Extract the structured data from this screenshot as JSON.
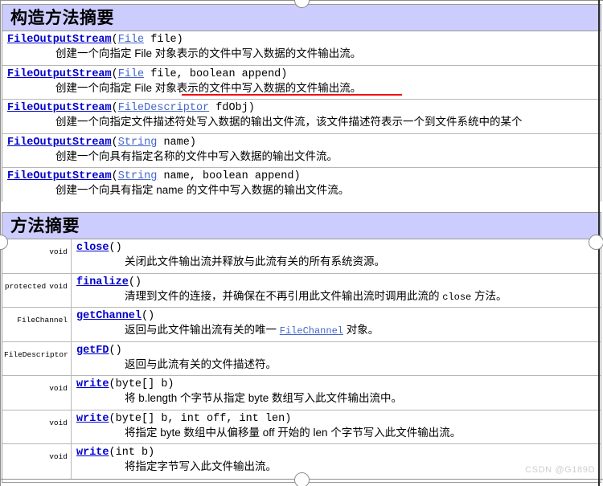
{
  "constructor_section": {
    "title": "构造方法摘要",
    "rows": [
      {
        "sig_name": "FileOutputStream",
        "sig_params_pre": "(",
        "sig_type": "File",
        "sig_params_post": " file)",
        "desc": "创建一个向指定 File 对象表示的文件中写入数据的文件输出流。"
      },
      {
        "sig_name": "FileOutputStream",
        "sig_params_pre": "(",
        "sig_type": "File",
        "sig_params_post": " file, boolean append)",
        "desc": "创建一个向指定 File 对象表示的文件中写入数据的文件输出流。"
      },
      {
        "sig_name": "FileOutputStream",
        "sig_params_pre": "(",
        "sig_type": "FileDescriptor",
        "sig_params_post": " fdObj)",
        "desc": "创建一个向指定文件描述符处写入数据的输出文件流，该文件描述符表示一个到文件系统中的某个"
      },
      {
        "sig_name": "FileOutputStream",
        "sig_params_pre": "(",
        "sig_type": "String",
        "sig_params_post": " name)",
        "desc": "创建一个向具有指定名称的文件中写入数据的输出文件流。"
      },
      {
        "sig_name": "FileOutputStream",
        "sig_params_pre": "(",
        "sig_type": "String",
        "sig_params_post": " name, boolean append)",
        "desc": "创建一个向具有指定 name 的文件中写入数据的输出文件流。"
      }
    ]
  },
  "method_section": {
    "title": "方法摘要",
    "rows": [
      {
        "modifier": "",
        "type": "void",
        "type_is_link": false,
        "name": "close",
        "params": "()",
        "desc_pre": "关闭此文件输出流并释放与此流有关的所有系统资源。",
        "desc_mid": "",
        "desc_post": ""
      },
      {
        "modifier": "protected",
        "type": "void",
        "type_is_link": false,
        "name": "finalize",
        "params": "()",
        "desc_pre": "清理到文件的连接，并确保在不再引用此文件输出流时调用此流的 ",
        "desc_mid": "close",
        "desc_post": " 方法。"
      },
      {
        "modifier": "",
        "type": "FileChannel",
        "type_is_link": true,
        "name": "getChannel",
        "params": "()",
        "desc_pre": "返回与此文件输出流有关的唯一 ",
        "desc_mid": "FileChannel",
        "desc_post": " 对象。",
        "desc_mid_is_link": true
      },
      {
        "modifier": "",
        "type": "FileDescriptor",
        "type_is_link": true,
        "name": "getFD",
        "params": "()",
        "desc_pre": "返回与此流有关的文件描述符。",
        "desc_mid": "",
        "desc_post": ""
      },
      {
        "modifier": "",
        "type": "void",
        "type_is_link": false,
        "name": "write",
        "params": "(byte[] b)",
        "desc_pre": "将 b.length 个字节从指定 byte 数组写入此文件输出流中。",
        "desc_mid": "",
        "desc_post": ""
      },
      {
        "modifier": "",
        "type": "void",
        "type_is_link": false,
        "name": "write",
        "params": "(byte[] b, int off, int len)",
        "desc_pre": "将指定 byte 数组中从偏移量 off 开始的 len 个字节写入此文件输出流。",
        "desc_mid": "",
        "desc_post": ""
      },
      {
        "modifier": "",
        "type": "void",
        "type_is_link": false,
        "name": "write",
        "params": "(int b)",
        "desc_pre": "将指定字节写入此文件输出流。",
        "desc_mid": "",
        "desc_post": ""
      }
    ]
  },
  "annotation": {
    "red_underline_present": true,
    "red_color": "#ee1111"
  },
  "watermark": {
    "text": "CSDN @G189D"
  },
  "colors": {
    "header_bg": "#ccccff",
    "link": "#0000cc",
    "type_link": "#4466cc",
    "border": "#9a9a9a"
  }
}
